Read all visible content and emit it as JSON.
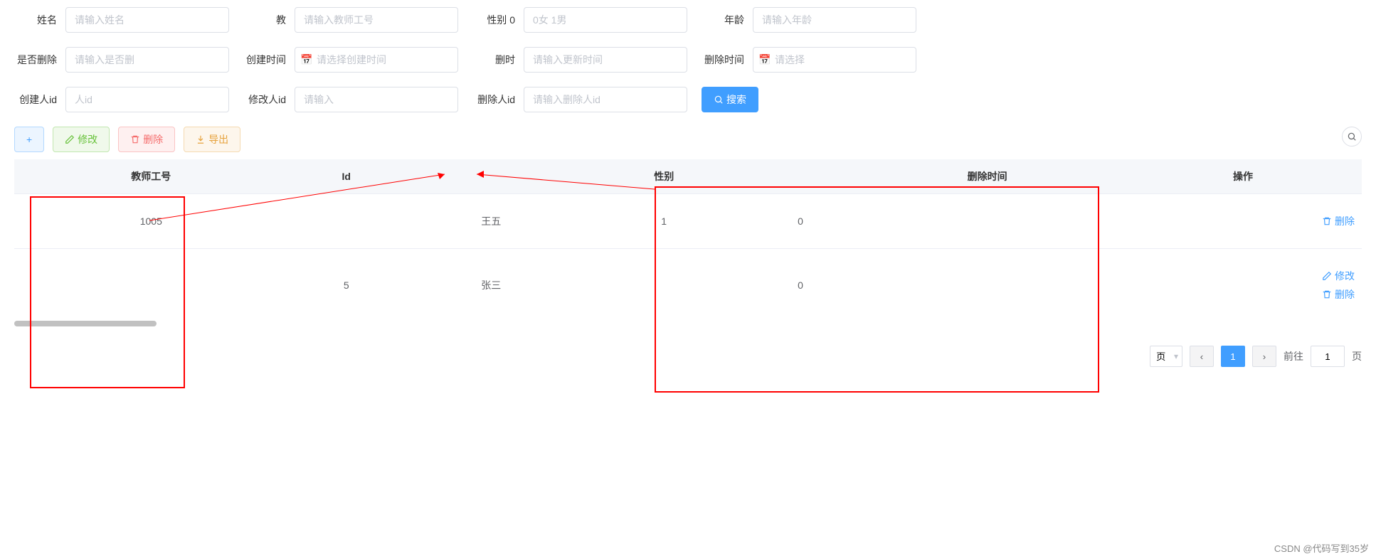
{
  "form": {
    "name": {
      "label": "姓名",
      "placeholder": "请输入姓名"
    },
    "teacherId": {
      "label": "教",
      "placeholder": "请输入教师工号"
    },
    "gender": {
      "label": "性别 0",
      "placeholder": "0女 1男"
    },
    "age": {
      "label": "年龄",
      "placeholder": "请输入年龄"
    },
    "isDeleted": {
      "label": "是否删除",
      "placeholder": "请输入是否删"
    },
    "createTime": {
      "label": "创建时间",
      "placeholder": "请选择创建时间"
    },
    "updateTime": {
      "label": "删时",
      "placeholder": "请输入更新时间"
    },
    "deleteTime": {
      "label": "删除时间",
      "placeholder": "请选择"
    },
    "creatorId": {
      "label": "创建人id",
      "placeholder": "人id"
    },
    "updaterId": {
      "label": "修改人id",
      "placeholder": "请输入"
    },
    "deleterId": {
      "label": "删除人id",
      "placeholder": "请输入删除人id"
    }
  },
  "buttons": {
    "search": "搜索",
    "add": "+",
    "edit": "修改",
    "delete": "删除",
    "export": "导出"
  },
  "table": {
    "headers": {
      "teacherId": "教师工号",
      "id": "Id",
      "name": "",
      "gender": "性别",
      "status": "",
      "deleteTime": "删除时间",
      "action": "操作"
    },
    "rows": [
      {
        "teacherId": "1005",
        "id": "",
        "name": "王五",
        "gender": "1",
        "status": "0",
        "deleteTime": "",
        "actions": {
          "delete": "删除"
        }
      },
      {
        "teacherId": "",
        "id": "5",
        "name": "张三",
        "gender": "",
        "status": "0",
        "deleteTime": "",
        "actions": {
          "edit": "修改",
          "delete": "删除"
        }
      }
    ]
  },
  "pagination": {
    "perPageSuffix": "页",
    "prev": "‹",
    "next": "›",
    "current": "1",
    "gotoLabel": "前往",
    "gotoValue": "1",
    "pageSuffix": "页"
  },
  "watermark": "CSDN @代码写到35岁"
}
